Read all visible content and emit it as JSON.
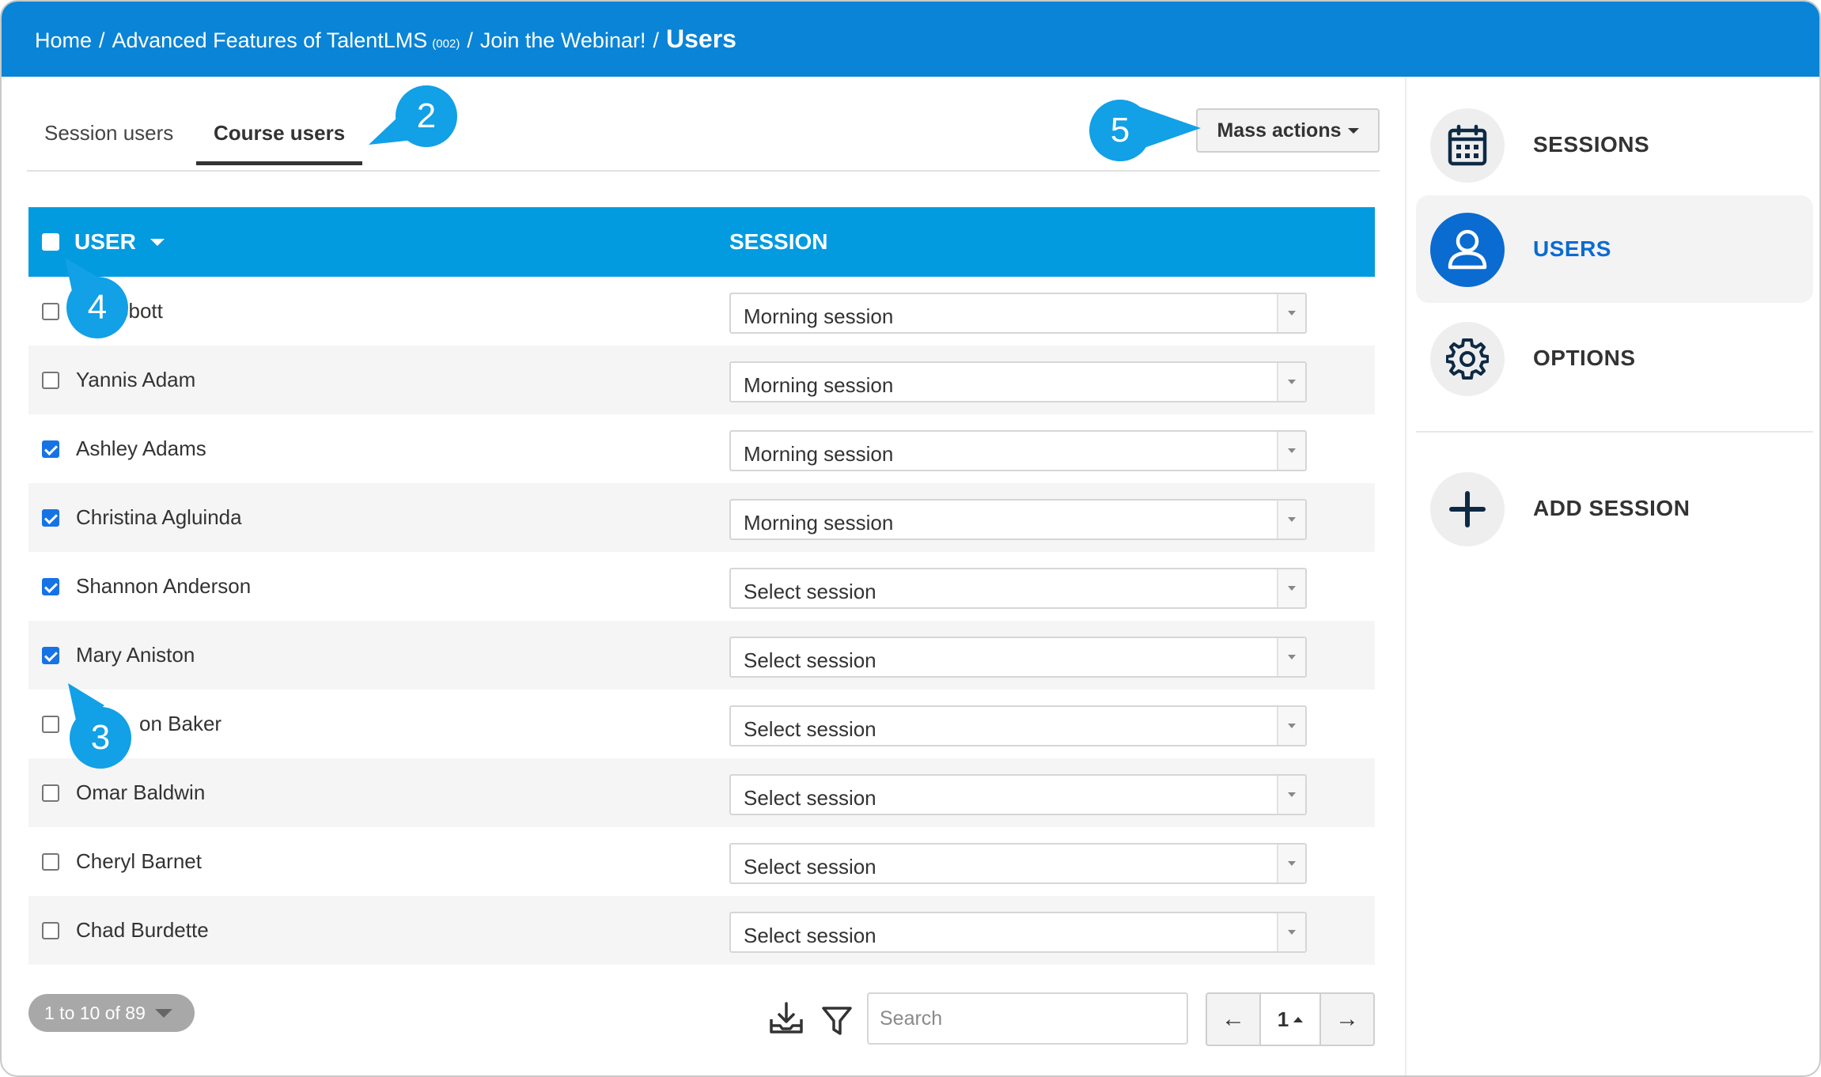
{
  "breadcrumb": {
    "home": "Home",
    "course": "Advanced Features of TalentLMS",
    "course_code": "(002)",
    "section": "Join the Webinar!",
    "current": "Users",
    "separator": "/"
  },
  "tabs": [
    {
      "label": "Session users",
      "active": false
    },
    {
      "label": "Course users",
      "active": true
    }
  ],
  "mass_actions": {
    "label": "Mass actions"
  },
  "table": {
    "columns": {
      "user": "USER",
      "session": "SESSION"
    },
    "rows": [
      {
        "name": "tte Abbott",
        "checked": false,
        "session": "Morning session"
      },
      {
        "name": "Yannis Adam",
        "checked": false,
        "session": "Morning session"
      },
      {
        "name": "Ashley Adams",
        "checked": true,
        "session": "Morning session"
      },
      {
        "name": "Christina Agluinda",
        "checked": true,
        "session": "Morning session"
      },
      {
        "name": "Shannon Anderson",
        "checked": true,
        "session": "Select session"
      },
      {
        "name": "Mary Aniston",
        "checked": true,
        "session": "Select session"
      },
      {
        "name": "on Baker",
        "checked": false,
        "session": "Select session"
      },
      {
        "name": "Omar Baldwin",
        "checked": false,
        "session": "Select session"
      },
      {
        "name": "Cheryl Barnet",
        "checked": false,
        "session": "Select session"
      },
      {
        "name": "Chad Burdette",
        "checked": false,
        "session": "Select session"
      }
    ]
  },
  "footer": {
    "count": "1 to 10 of 89",
    "search_placeholder": "Search",
    "prev": "←",
    "page": "1",
    "next": "→"
  },
  "side": {
    "items": [
      {
        "label": "SESSIONS",
        "icon": "calendar-icon",
        "active": false
      },
      {
        "label": "USERS",
        "icon": "user-icon",
        "active": true
      },
      {
        "label": "OPTIONS",
        "icon": "gear-icon",
        "active": false
      },
      {
        "label": "ADD SESSION",
        "icon": "plus-icon",
        "active": false
      }
    ]
  },
  "callouts": [
    "2",
    "3",
    "4",
    "5"
  ],
  "colors": {
    "topbar": "#0a84d6",
    "table_header": "#039be0",
    "accent": "#0a6bd1",
    "callout": "#12a0e6"
  }
}
